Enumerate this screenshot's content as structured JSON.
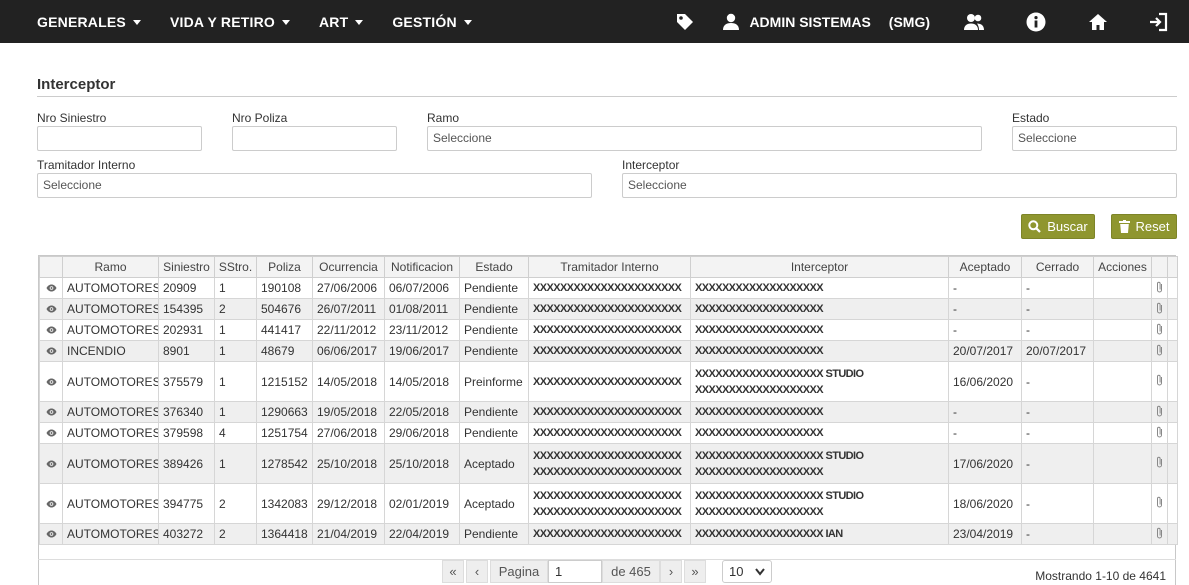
{
  "nav": {
    "menus": [
      {
        "label": "GENERALES"
      },
      {
        "label": "VIDA Y RETIRO"
      },
      {
        "label": "ART"
      },
      {
        "label": "GESTIÓN"
      }
    ],
    "user_name": "ADMIN SISTEMAS",
    "user_org": "(SMG)"
  },
  "page": {
    "title": "Interceptor"
  },
  "filters": {
    "nro_siniestro_label": "Nro Siniestro",
    "nro_poliza_label": "Nro Poliza",
    "ramo_label": "Ramo",
    "ramo_value": "Seleccione",
    "estado_label": "Estado",
    "estado_value": "Seleccione",
    "tramitador_label": "Tramitador Interno",
    "tramitador_value": "Seleccione",
    "interceptor_label": "Interceptor",
    "interceptor_value": "Seleccione"
  },
  "buttons": {
    "buscar": "Buscar",
    "reset": "Reset"
  },
  "table": {
    "columns": [
      "Ramo",
      "Siniestro",
      "SStro.",
      "Poliza",
      "Ocurrencia",
      "Notificacion",
      "Estado",
      "Tramitador Interno",
      "Interceptor",
      "Aceptado",
      "Cerrado",
      "Acciones"
    ],
    "rows": [
      {
        "ramo": "AUTOMOTORES",
        "siniestro": "20909",
        "sstro": "1",
        "poliza": "190108",
        "ocurrencia": "27/06/2006",
        "notificacion": "06/07/2006",
        "estado": "Pendiente",
        "tramitador": [
          "XXXXXXXXXXXXXXXXXXXXXX"
        ],
        "interceptor": [
          "XXXXXXXXXXXXXXXXXXX"
        ],
        "aceptado": "-",
        "cerrado": "-"
      },
      {
        "ramo": "AUTOMOTORES",
        "siniestro": "154395",
        "sstro": "2",
        "poliza": "504676",
        "ocurrencia": "26/07/2011",
        "notificacion": "01/08/2011",
        "estado": "Pendiente",
        "tramitador": [
          "XXXXXXXXXXXXXXXXXXXXXX"
        ],
        "interceptor": [
          "XXXXXXXXXXXXXXXXXXX"
        ],
        "aceptado": "-",
        "cerrado": "-"
      },
      {
        "ramo": "AUTOMOTORES",
        "siniestro": "202931",
        "sstro": "1",
        "poliza": "441417",
        "ocurrencia": "22/11/2012",
        "notificacion": "23/11/2012",
        "estado": "Pendiente",
        "tramitador": [
          "XXXXXXXXXXXXXXXXXXXXXX"
        ],
        "interceptor": [
          "XXXXXXXXXXXXXXXXXXX"
        ],
        "aceptado": "-",
        "cerrado": "-"
      },
      {
        "ramo": "INCENDIO",
        "siniestro": "8901",
        "sstro": "1",
        "poliza": "48679",
        "ocurrencia": "06/06/2017",
        "notificacion": "19/06/2017",
        "estado": "Pendiente",
        "tramitador": [
          "XXXXXXXXXXXXXXXXXXXXXX"
        ],
        "interceptor": [
          "XXXXXXXXXXXXXXXXXXX"
        ],
        "aceptado": "20/07/2017",
        "cerrado": "20/07/2017"
      },
      {
        "ramo": "AUTOMOTORES",
        "siniestro": "375579",
        "sstro": "1",
        "poliza": "1215152",
        "ocurrencia": "14/05/2018",
        "notificacion": "14/05/2018",
        "estado": "Preinforme",
        "tramitador": [
          "XXXXXXXXXXXXXXXXXXXXXX"
        ],
        "interceptor": [
          "XXXXXXXXXXXXXXXXXXX STUDIO",
          "XXXXXXXXXXXXXXXXXXX"
        ],
        "aceptado": "16/06/2020",
        "cerrado": "-"
      },
      {
        "ramo": "AUTOMOTORES",
        "siniestro": "376340",
        "sstro": "1",
        "poliza": "1290663",
        "ocurrencia": "19/05/2018",
        "notificacion": "22/05/2018",
        "estado": "Pendiente",
        "tramitador": [
          "XXXXXXXXXXXXXXXXXXXXXX"
        ],
        "interceptor": [
          "XXXXXXXXXXXXXXXXXXX"
        ],
        "aceptado": "-",
        "cerrado": "-"
      },
      {
        "ramo": "AUTOMOTORES",
        "siniestro": "379598",
        "sstro": "4",
        "poliza": "1251754",
        "ocurrencia": "27/06/2018",
        "notificacion": "29/06/2018",
        "estado": "Pendiente",
        "tramitador": [
          "XXXXXXXXXXXXXXXXXXXXXX"
        ],
        "interceptor": [
          "XXXXXXXXXXXXXXXXXXX"
        ],
        "aceptado": "-",
        "cerrado": "-"
      },
      {
        "ramo": "AUTOMOTORES",
        "siniestro": "389426",
        "sstro": "1",
        "poliza": "1278542",
        "ocurrencia": "25/10/2018",
        "notificacion": "25/10/2018",
        "estado": "Aceptado",
        "tramitador": [
          "XXXXXXXXXXXXXXXXXXXXXX",
          "XXXXXXXXXXXXXXXXXXXXXX"
        ],
        "interceptor": [
          "XXXXXXXXXXXXXXXXXXX STUDIO",
          "XXXXXXXXXXXXXXXXXXX"
        ],
        "aceptado": "17/06/2020",
        "cerrado": "-"
      },
      {
        "ramo": "AUTOMOTORES",
        "siniestro": "394775",
        "sstro": "2",
        "poliza": "1342083",
        "ocurrencia": "29/12/2018",
        "notificacion": "02/01/2019",
        "estado": "Aceptado",
        "tramitador": [
          "XXXXXXXXXXXXXXXXXXXXXX",
          "XXXXXXXXXXXXXXXXXXXXXX"
        ],
        "interceptor": [
          "XXXXXXXXXXXXXXXXXXX STUDIO",
          "XXXXXXXXXXXXXXXXXXX"
        ],
        "aceptado": "18/06/2020",
        "cerrado": "-"
      },
      {
        "ramo": "AUTOMOTORES",
        "siniestro": "403272",
        "sstro": "2",
        "poliza": "1364418",
        "ocurrencia": "21/04/2019",
        "notificacion": "22/04/2019",
        "estado": "Pendiente",
        "tramitador": [
          "XXXXXXXXXXXXXXXXXXXXXX"
        ],
        "interceptor": [
          "XXXXXXXXXXXXXXXXXXX IAN"
        ],
        "aceptado": "23/04/2019",
        "cerrado": "-"
      }
    ]
  },
  "pagination": {
    "first": "«",
    "prev": "‹",
    "page_label": "Pagina",
    "page_value": "1",
    "of_label": "de 465",
    "next": "›",
    "last": "»",
    "page_size": "10",
    "showing": "Mostrando 1-10 de 4641"
  }
}
